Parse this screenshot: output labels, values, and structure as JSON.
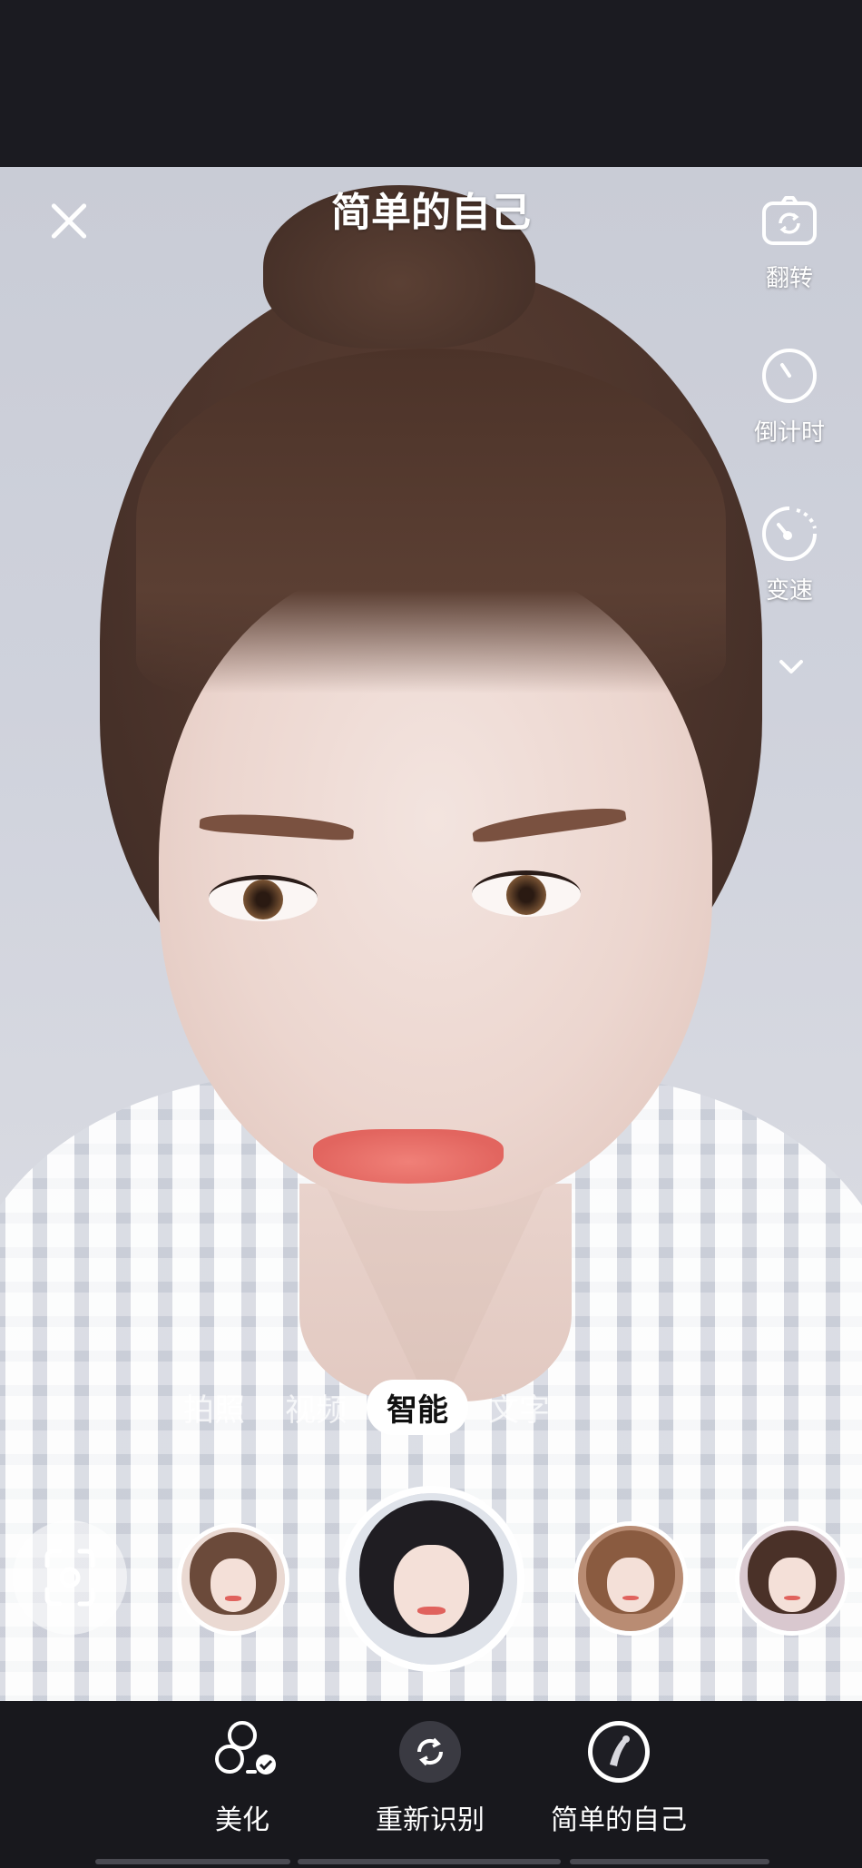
{
  "header": {
    "title": "简单的自己"
  },
  "side_tools": [
    {
      "label": "翻转",
      "icon": "camera-flip-icon"
    },
    {
      "label": "倒计时",
      "icon": "timer-icon"
    },
    {
      "label": "变速",
      "icon": "speed-icon"
    }
  ],
  "modes": {
    "items": [
      "拍照",
      "视频",
      "智能",
      "文字"
    ],
    "selected": "智能"
  },
  "effects": {
    "selected_index": 1
  },
  "bottom_bar": {
    "items": [
      {
        "label": "美化",
        "icon": "beautify-icon"
      },
      {
        "label": "重新识别",
        "icon": "refresh-icon"
      },
      {
        "label": "简单的自己",
        "icon": "effect-thumbnail-icon"
      }
    ]
  },
  "colors": {
    "bar_background": "#1b1b21",
    "overlay_text": "#ffffff",
    "active_tab_bg": "#ffffff"
  }
}
